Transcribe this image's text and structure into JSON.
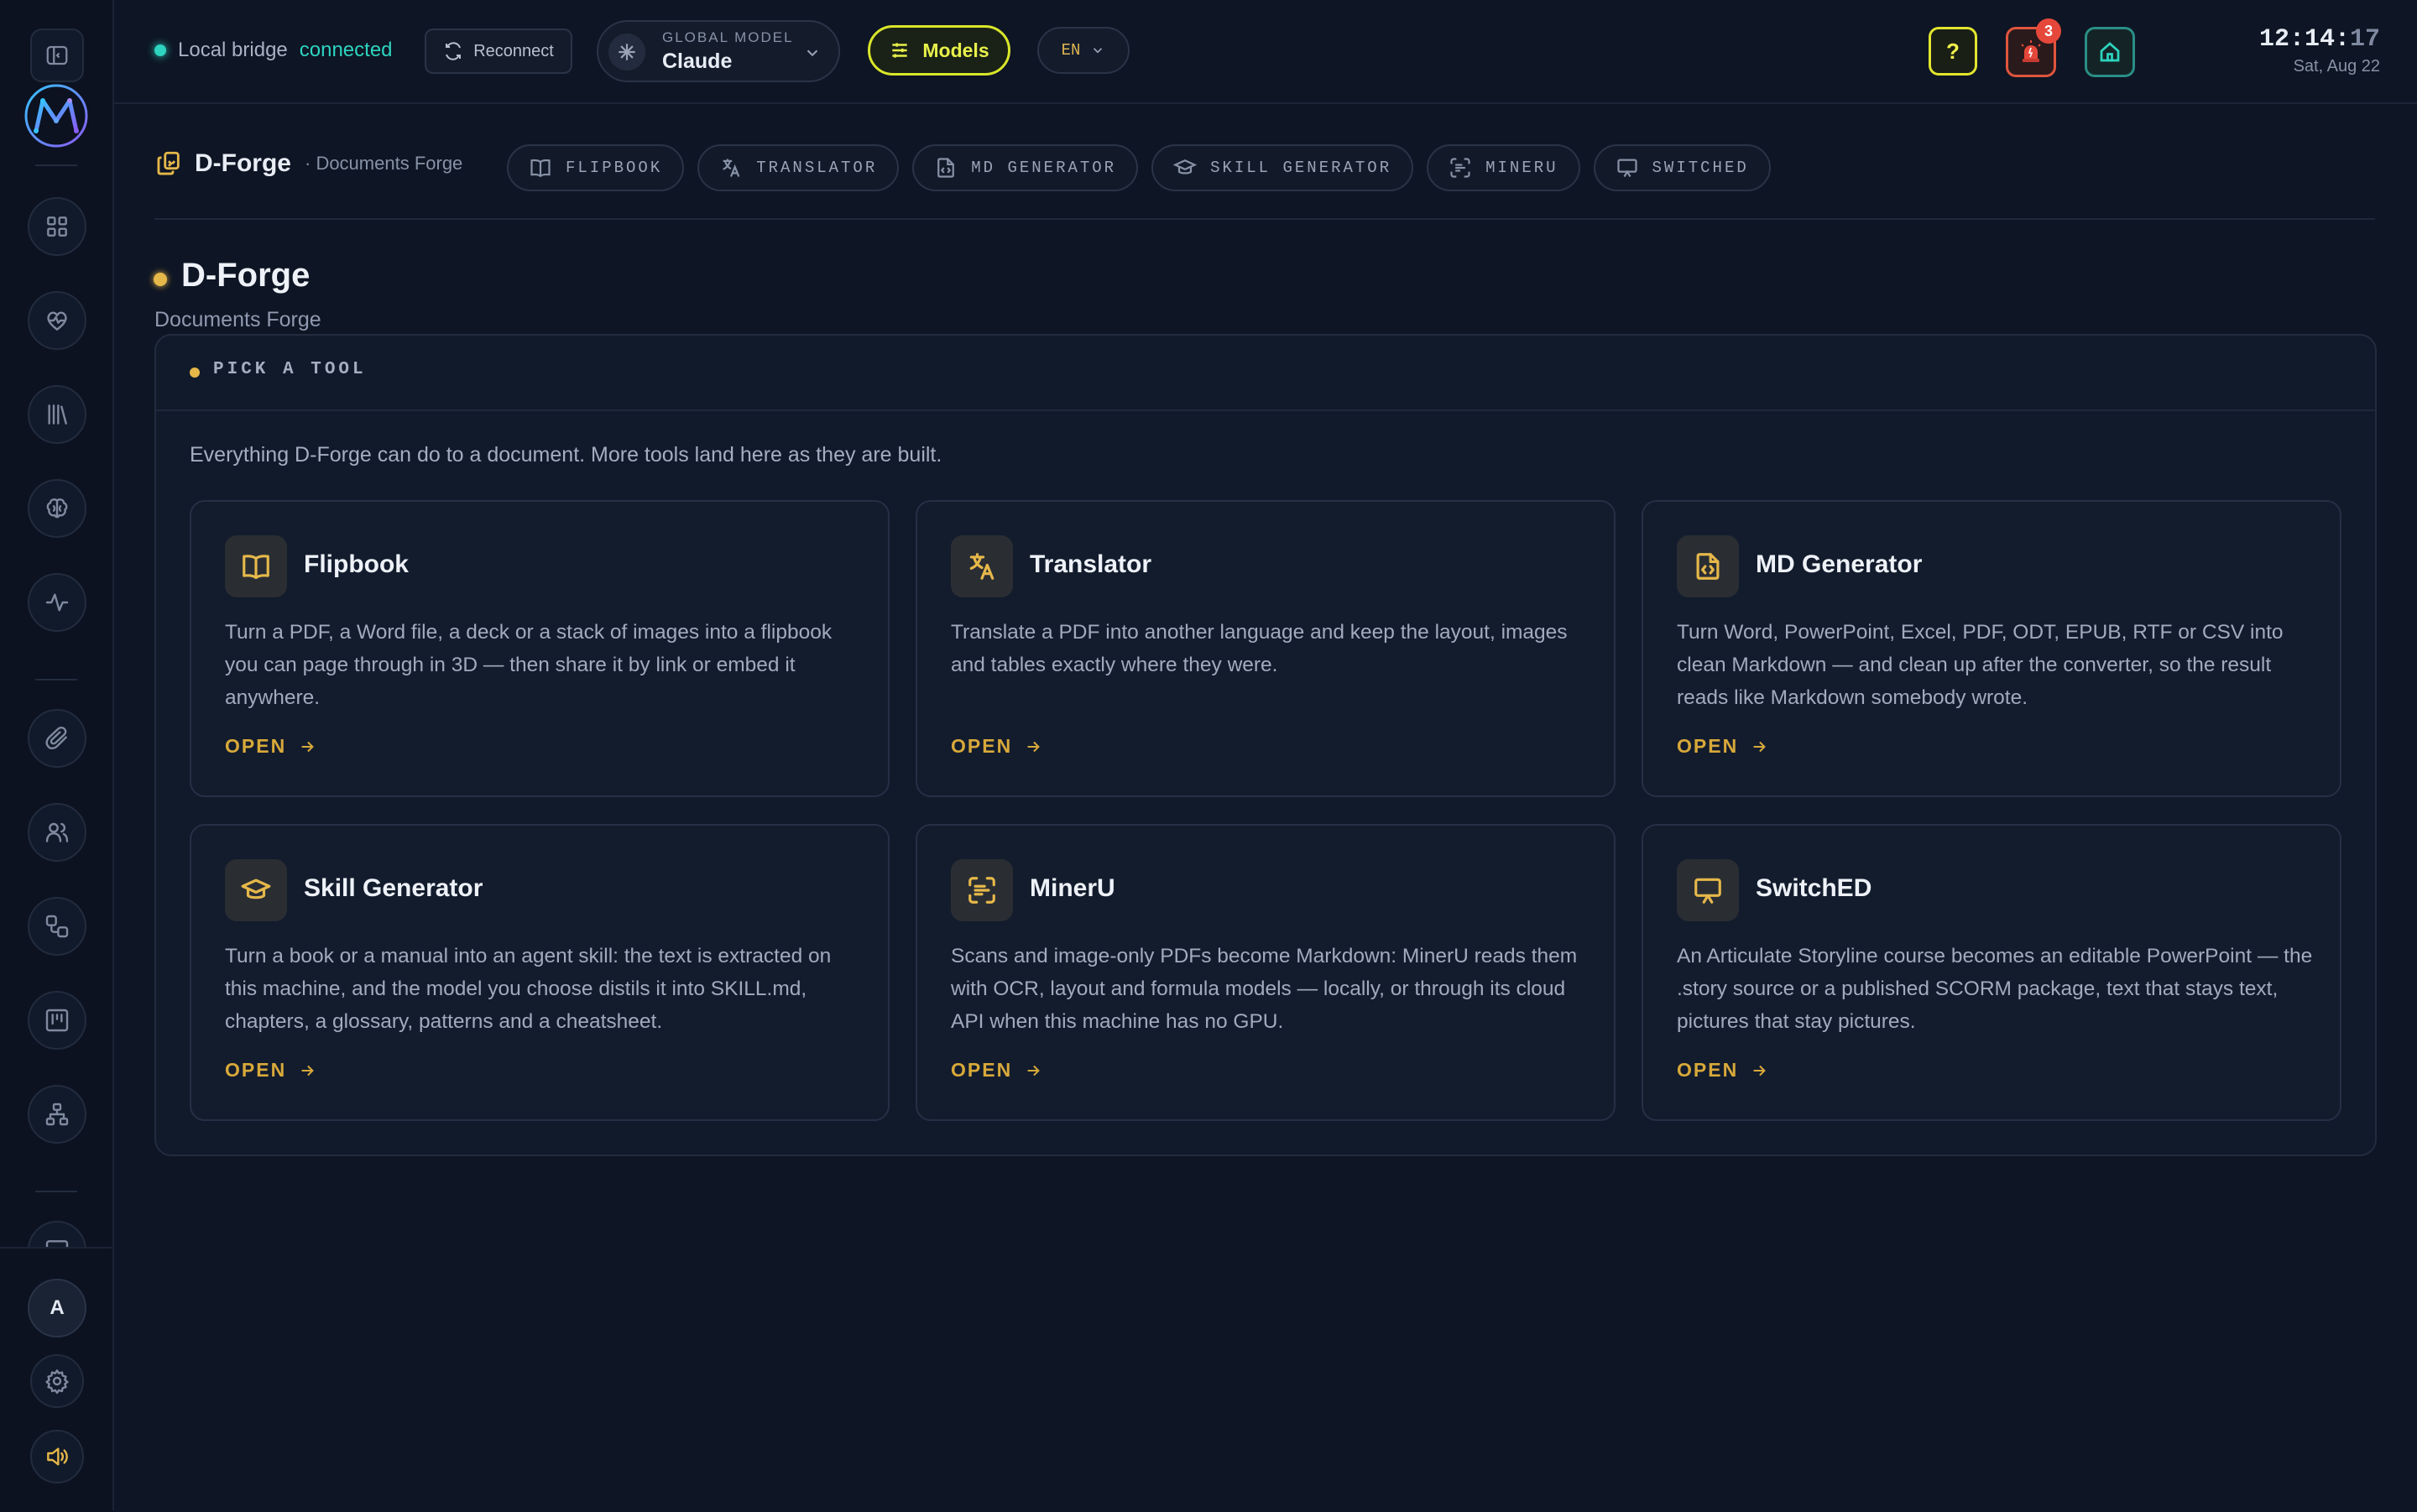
{
  "topbar": {
    "status_prefix": "Local bridge",
    "status_state": "connected",
    "reconnect_label": "Reconnect",
    "model_label": "GLOBAL MODEL",
    "model_value": "Claude",
    "models_label": "Models",
    "language": "EN",
    "help_label": "?",
    "alert_count": "3",
    "clock_hm": "12:14:",
    "clock_s": "17",
    "date": "Sat, Aug 22"
  },
  "breadcrumb": {
    "name": "D-Forge",
    "sub": "· Documents Forge"
  },
  "tabs": [
    {
      "label": "FLIPBOOK",
      "icon": "book-icon"
    },
    {
      "label": "TRANSLATOR",
      "icon": "translate-icon"
    },
    {
      "label": "MD GENERATOR",
      "icon": "file-code-icon"
    },
    {
      "label": "SKILL GENERATOR",
      "icon": "graduation-cap-icon"
    },
    {
      "label": "MINERU",
      "icon": "scan-text-icon"
    },
    {
      "label": "SWITCHED",
      "icon": "presentation-icon"
    }
  ],
  "page": {
    "title": "D-Forge",
    "subtitle": "Documents Forge"
  },
  "panel": {
    "heading": "PICK A TOOL",
    "intro": "Everything D-Forge can do to a document. More tools land here as they are built."
  },
  "cards": [
    {
      "title": "Flipbook",
      "icon": "book-icon",
      "desc": "Turn a PDF, a Word file, a deck or a stack of images into a flipbook you can page through in 3D — then share it by link or embed it anywhere.",
      "action": "OPEN"
    },
    {
      "title": "Translator",
      "icon": "translate-icon",
      "desc": "Translate a PDF into another language and keep the layout, images and tables exactly where they were.",
      "action": "OPEN"
    },
    {
      "title": "MD Generator",
      "icon": "file-code-icon",
      "desc": "Turn Word, PowerPoint, Excel, PDF, ODT, EPUB, RTF or CSV into clean Markdown — and clean up after the converter, so the result reads like Markdown somebody wrote.",
      "action": "OPEN"
    },
    {
      "title": "Skill Generator",
      "icon": "graduation-cap-icon",
      "desc": "Turn a book or a manual into an agent skill: the text is extracted on this machine, and the model you choose distils it into SKILL.md, chapters, a glossary, patterns and a cheatsheet.",
      "action": "OPEN"
    },
    {
      "title": "MinerU",
      "icon": "scan-text-icon",
      "desc": "Scans and image-only PDFs become Markdown: MinerU reads them with OCR, layout and formula models — locally, or through its cloud API when this machine has no GPU.",
      "action": "OPEN"
    },
    {
      "title": "SwitchED",
      "icon": "presentation-icon",
      "desc": "An Articulate Storyline course becomes an editable PowerPoint — the .story source or a published SCORM package, text that stays text, pictures that stay pictures.",
      "action": "OPEN"
    }
  ],
  "sidebar": {
    "avatar_initial": "A",
    "icons": [
      "panel-toggle-icon",
      "grid-icon",
      "heart-pulse-icon",
      "library-icon",
      "brain-icon",
      "activity-icon",
      "paperclip-icon",
      "users-icon",
      "workflow-icon",
      "kanban-icon",
      "sitemap-icon",
      "monitor-icon",
      "settings-icon",
      "volume-icon"
    ]
  },
  "colors": {
    "background": "#0e1524",
    "accent": "#e6b84a",
    "connected": "#2dd4bf",
    "models_highlight": "#d9e62a",
    "alert": "#e5483b"
  }
}
